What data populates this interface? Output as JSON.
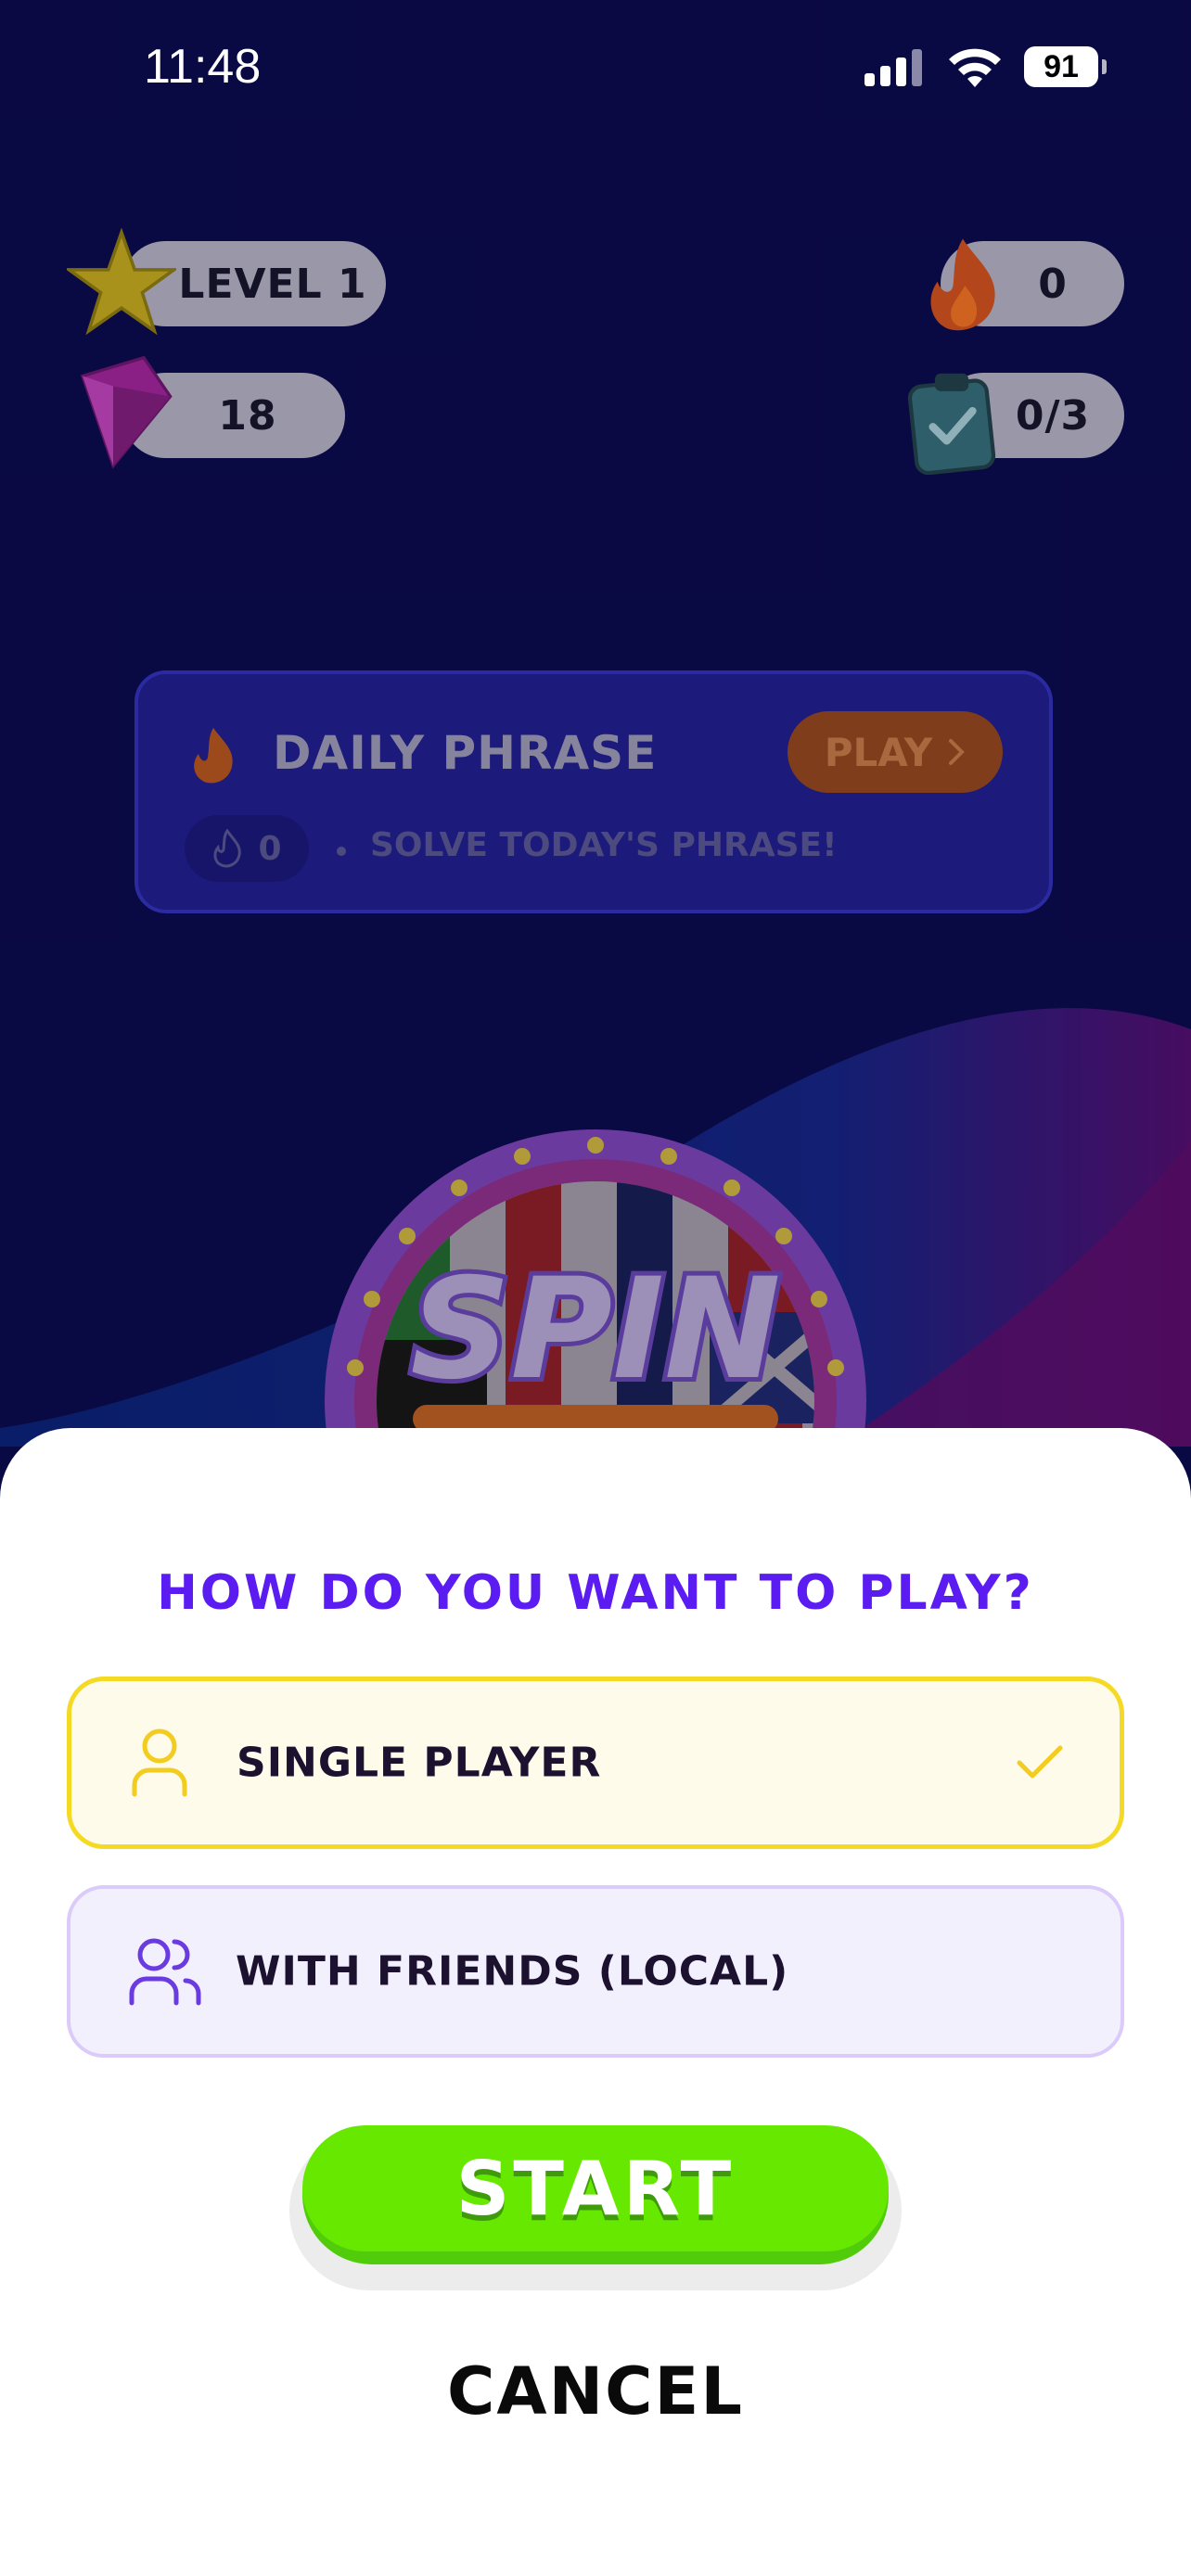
{
  "status": {
    "time": "11:48",
    "battery": "91"
  },
  "stats": {
    "level": "LEVEL 1",
    "gems": "18",
    "streak": "0",
    "tasks": "0/3"
  },
  "daily": {
    "title": "DAILY PHRASE",
    "play": "PLAY",
    "streak": "0",
    "subtitle": "SOLVE TODAY'S PHRASE!"
  },
  "logo": {
    "word1": "SPIN"
  },
  "modal": {
    "title": "HOW DO YOU WANT TO PLAY?",
    "options": [
      {
        "label": "SINGLE PLAYER",
        "icon": "user-icon",
        "selected": true
      },
      {
        "label": "WITH FRIENDS (LOCAL)",
        "icon": "users-icon",
        "selected": false
      }
    ],
    "start": "START",
    "cancel": "CANCEL"
  },
  "colors": {
    "background": "#0c0b52",
    "accent_purple": "#5b1cf2",
    "selected_border": "#f4da25",
    "start_green": "#66e800"
  }
}
